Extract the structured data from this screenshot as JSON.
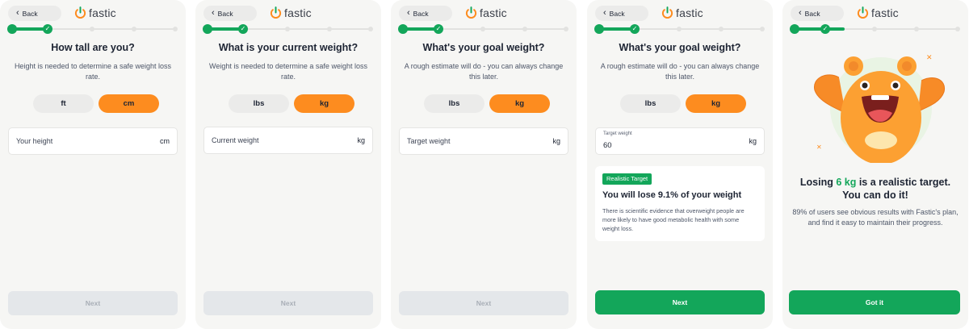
{
  "app": {
    "logo_text": "fastic",
    "back_label": "Back"
  },
  "screens": [
    {
      "title": "How tall are you?",
      "subtitle": "Height is needed to determine a safe weight loss rate.",
      "units": [
        "ft",
        "cm"
      ],
      "active_unit": "cm",
      "field": {
        "placeholder": "Your height",
        "suffix": "cm"
      },
      "next_label": "Next",
      "next_enabled": false
    },
    {
      "title": "What is your current weight?",
      "subtitle": "Weight is needed to determine a safe weight loss rate.",
      "units": [
        "lbs",
        "kg"
      ],
      "active_unit": "kg",
      "field": {
        "placeholder": "Current weight",
        "suffix": "kg"
      },
      "next_label": "Next",
      "next_enabled": false
    },
    {
      "title": "What's your goal weight?",
      "subtitle": "A rough estimate will do - you can always change this later.",
      "units": [
        "lbs",
        "kg"
      ],
      "active_unit": "kg",
      "field": {
        "placeholder": "Target weight",
        "suffix": "kg"
      },
      "next_label": "Next",
      "next_enabled": false
    },
    {
      "title": "What's your goal weight?",
      "subtitle": "A rough estimate will do - you can always change this later.",
      "units": [
        "lbs",
        "kg"
      ],
      "active_unit": "kg",
      "field": {
        "label": "Target weight",
        "value": "60",
        "suffix": "kg"
      },
      "result": {
        "badge": "Realistic Target",
        "title": "You will lose 9.1% of your weight",
        "body": "There is scientific evidence that overweight people are more likely to have good metabolic health with some weight loss."
      },
      "next_label": "Next",
      "next_enabled": true
    },
    {
      "final_title_pre": "Losing ",
      "final_title_highlight": "6 kg",
      "final_title_post": " is a realistic target. You can do it!",
      "final_body": "89% of users see obvious results with Fastic's plan, and find it easy to maintain their progress.",
      "button_label": "Got it"
    }
  ],
  "progress": {
    "total_steps": 5,
    "screens_current_step": [
      2,
      2,
      2,
      2,
      2
    ]
  },
  "colors": {
    "accent_green": "#13a65a",
    "accent_orange": "#fd8c1f",
    "background": "#f6f6f4"
  },
  "icons": {
    "back": "chevron-left-icon",
    "logo": "fastic-power-logo-icon",
    "check": "check-icon",
    "mascot": "bear-mascot-illustration"
  }
}
